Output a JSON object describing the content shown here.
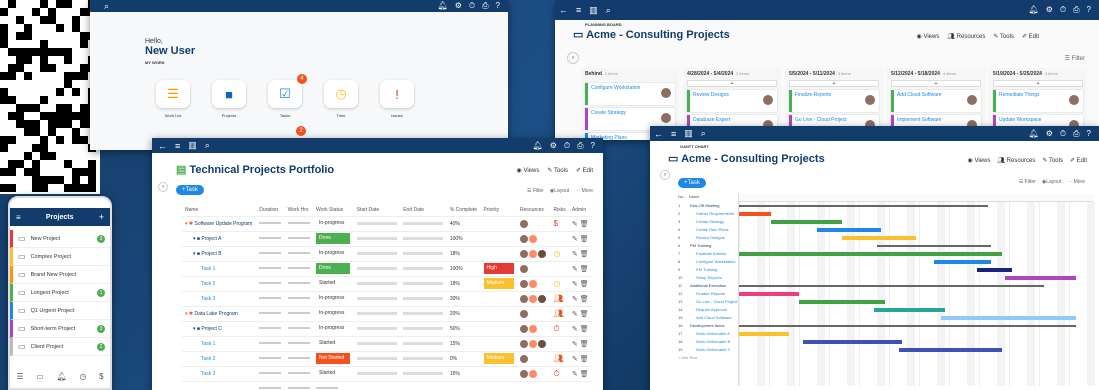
{
  "home": {
    "greeting": "Hello,",
    "user": "New User",
    "section": "MY WORK",
    "tiles": [
      {
        "label": "Work List",
        "color": "#ff9800",
        "icon": "list-icon"
      },
      {
        "label": "Projects",
        "color": "#1565c0",
        "icon": "folder-icon"
      },
      {
        "label": "Tasks",
        "color": "#1e88e5",
        "icon": "checkbox-icon",
        "badge": "4"
      },
      {
        "label": "Time",
        "color": "#fbc02d",
        "icon": "clock-icon"
      },
      {
        "label": "Issues",
        "color": "#e53935",
        "icon": "alert-icon"
      }
    ],
    "second_badge": "2"
  },
  "board": {
    "subtitle": "PLANNING BOARD",
    "title": "Acme - Consulting Projects",
    "views": "Views",
    "resources": "Resources",
    "tools": "Tools",
    "edit": "Edit",
    "filter": "Filter",
    "columns": [
      {
        "head": "Behind",
        "sub": "2 items"
      },
      {
        "head": "4/28/2024 - 5/4/2024",
        "sub": "3 items"
      },
      {
        "head": "5/5/2024 - 5/11/2024",
        "sub": "3 items"
      },
      {
        "head": "5/12/2024 - 5/18/2024",
        "sub": "4 items"
      },
      {
        "head": "5/19/2024 - 5/25/2024",
        "sub": "4 items"
      }
    ],
    "cards": [
      [
        "Configure Workstation",
        "Create Strategy",
        "Marketing Plans"
      ],
      [
        "Review Designs",
        "Database Expert"
      ],
      [
        "Finalize Reports",
        "Go Live - Cloud Project"
      ],
      [
        "Add Cloud Software",
        "Implement Software"
      ],
      [
        "Remediate Things",
        "Update Workspace"
      ]
    ]
  },
  "portfolio": {
    "title": "Technical Projects Portfolio",
    "add": "+Task",
    "views": "Views",
    "tools": "Tools",
    "edit": "Edit",
    "filter": "Filter",
    "layout": "Layout",
    "more": "More",
    "headers": [
      "Name",
      "Duration",
      "Work Hrs",
      "Work Status",
      "Start Date",
      "End Date",
      "% Complete",
      "Priority",
      "Resources",
      "Risks",
      "Admin"
    ],
    "rows": [
      {
        "name": "Software Update Program",
        "level": 0,
        "status": "In-progress",
        "scolor": "",
        "pct": "40%",
        "prio": "",
        "pcolor": "",
        "risk": "dollar"
      },
      {
        "name": "Project A",
        "level": 1,
        "status": "Done",
        "scolor": "#4caf50",
        "pct": "100%",
        "prio": "",
        "pcolor": "",
        "risk": ""
      },
      {
        "name": "Project B",
        "level": 1,
        "status": "In-progress",
        "scolor": "",
        "pct": "18%",
        "prio": "",
        "pcolor": "",
        "risk": "clock"
      },
      {
        "name": "Task 1",
        "level": 2,
        "status": "Done",
        "scolor": "#4caf50",
        "pct": "100%",
        "prio": "High",
        "pcolor": "#e53935",
        "risk": ""
      },
      {
        "name": "Task 2",
        "level": 2,
        "status": "Started",
        "scolor": "",
        "pct": "18%",
        "prio": "Medium",
        "pcolor": "#fbc02d",
        "risk": "clock"
      },
      {
        "name": "Task 3",
        "level": 2,
        "status": "In-progress",
        "scolor": "",
        "pct": "30%",
        "prio": "",
        "pcolor": "",
        "risk": "people"
      },
      {
        "name": "Data Lake Program",
        "level": 0,
        "status": "In-progress",
        "scolor": "",
        "pct": "20%",
        "prio": "",
        "pcolor": "",
        "risk": "people"
      },
      {
        "name": "Project C",
        "level": 1,
        "status": "In-progress",
        "scolor": "",
        "pct": "50%",
        "prio": "",
        "pcolor": "",
        "risk": "stopwatch"
      },
      {
        "name": "Task 1",
        "level": 2,
        "status": "Started",
        "scolor": "",
        "pct": "15%",
        "prio": "",
        "pcolor": "",
        "risk": ""
      },
      {
        "name": "Task 2",
        "level": 2,
        "status": "Not Started",
        "scolor": "#f4511e",
        "pct": "0%",
        "prio": "Medium",
        "pcolor": "#fbc02d",
        "risk": "people"
      },
      {
        "name": "Task 3",
        "level": 2,
        "status": "Started",
        "scolor": "",
        "pct": "15%",
        "prio": "",
        "pcolor": "",
        "risk": "stopwatch"
      }
    ]
  },
  "gantt": {
    "subtitle": "GANTT CHART",
    "title": "Acme - Consulting Projects",
    "views": "Views",
    "resources": "Resources",
    "tools": "Tools",
    "edit": "Edit",
    "filter": "Filter",
    "layout": "Layout",
    "more": "More",
    "add": "+Task",
    "col_num": "Nu...",
    "col_name": "Name",
    "add_row": "Add Row",
    "tasks": [
      {
        "n": "1",
        "name": "Kick-Off Meeting",
        "grp": true,
        "s": 0,
        "d": 0.7,
        "c": "#666"
      },
      {
        "n": "2",
        "name": "Gather Requirements",
        "s": 0,
        "d": 0.09,
        "c": "#f4511e"
      },
      {
        "n": "3",
        "name": "Create Strategy",
        "s": 0.09,
        "d": 0.2,
        "c": "#43a047"
      },
      {
        "n": "4",
        "name": "Create Rem Plans",
        "s": 0.22,
        "d": 0.18,
        "c": "#1e88e5"
      },
      {
        "n": "5",
        "name": "Review Designs",
        "s": 0.29,
        "d": 0.21,
        "c": "#fbc02d"
      },
      {
        "n": "6",
        "name": "PM Training",
        "grp": true,
        "s": 0.39,
        "d": 0.32,
        "c": "#666"
      },
      {
        "n": "7",
        "name": "Facilitate Admins",
        "s": 0,
        "d": 0.74,
        "c": "#43a047"
      },
      {
        "n": "8",
        "name": "Configure Workstation",
        "s": 0.55,
        "d": 0.16,
        "c": "#1e88e5"
      },
      {
        "n": "9",
        "name": "PM Training",
        "s": 0.67,
        "d": 0.1,
        "c": "#1a237e"
      },
      {
        "n": "10",
        "name": "Setup Reports",
        "s": 0.75,
        "d": 0.2,
        "c": "#ab47bc"
      },
      {
        "n": "11",
        "name": "Additional Execution",
        "grp": true,
        "s": 0,
        "d": 0.86,
        "c": "#666"
      },
      {
        "n": "12",
        "name": "Finalize Reports",
        "s": 0,
        "d": 0.17,
        "c": "#ec407a"
      },
      {
        "n": "13",
        "name": "Go Live - Cloud Project",
        "s": 0.17,
        "d": 0.24,
        "c": "#43a047"
      },
      {
        "n": "14",
        "name": "Require Approval",
        "s": 0.38,
        "d": 0.2,
        "c": "#26a69a"
      },
      {
        "n": "15",
        "name": "Add Cloud Software",
        "s": 0.57,
        "d": 0.38,
        "c": "#90caf9"
      },
      {
        "n": "16",
        "name": "Development Items",
        "grp": true,
        "s": 0,
        "d": 0.95,
        "c": "#666"
      },
      {
        "n": "17",
        "name": "Work Deliverable A",
        "s": 0,
        "d": 0.14,
        "c": "#fbc02d"
      },
      {
        "n": "18",
        "name": "Work Deliverable B",
        "s": 0.18,
        "d": 0.28,
        "c": "#3f51b5"
      },
      {
        "n": "19",
        "name": "Work Deliverable C",
        "s": 0.45,
        "d": 0.29,
        "c": "#3f51b5"
      }
    ]
  },
  "mobile": {
    "title": "Projects",
    "add": "+",
    "items": [
      {
        "name": "New Project",
        "color": "#e53935",
        "badge": "3",
        "bcolor": "#4caf50"
      },
      {
        "name": "Complex Project",
        "color": "#fbc02d",
        "badge": "",
        "bcolor": ""
      },
      {
        "name": "Brand New Project",
        "color": "#ff9800",
        "badge": "",
        "bcolor": ""
      },
      {
        "name": "Longest Project",
        "color": "#4caf50",
        "badge": "1",
        "bcolor": "#4caf50"
      },
      {
        "name": "Q1 Urgent Project",
        "color": "#1e88e5",
        "badge": "",
        "bcolor": ""
      },
      {
        "name": "Short-term Project",
        "color": "#ab47bc",
        "badge": "3",
        "bcolor": "#4caf50"
      },
      {
        "name": "Client Project",
        "color": "#bbb",
        "badge": "2",
        "bcolor": "#4caf50"
      }
    ]
  }
}
